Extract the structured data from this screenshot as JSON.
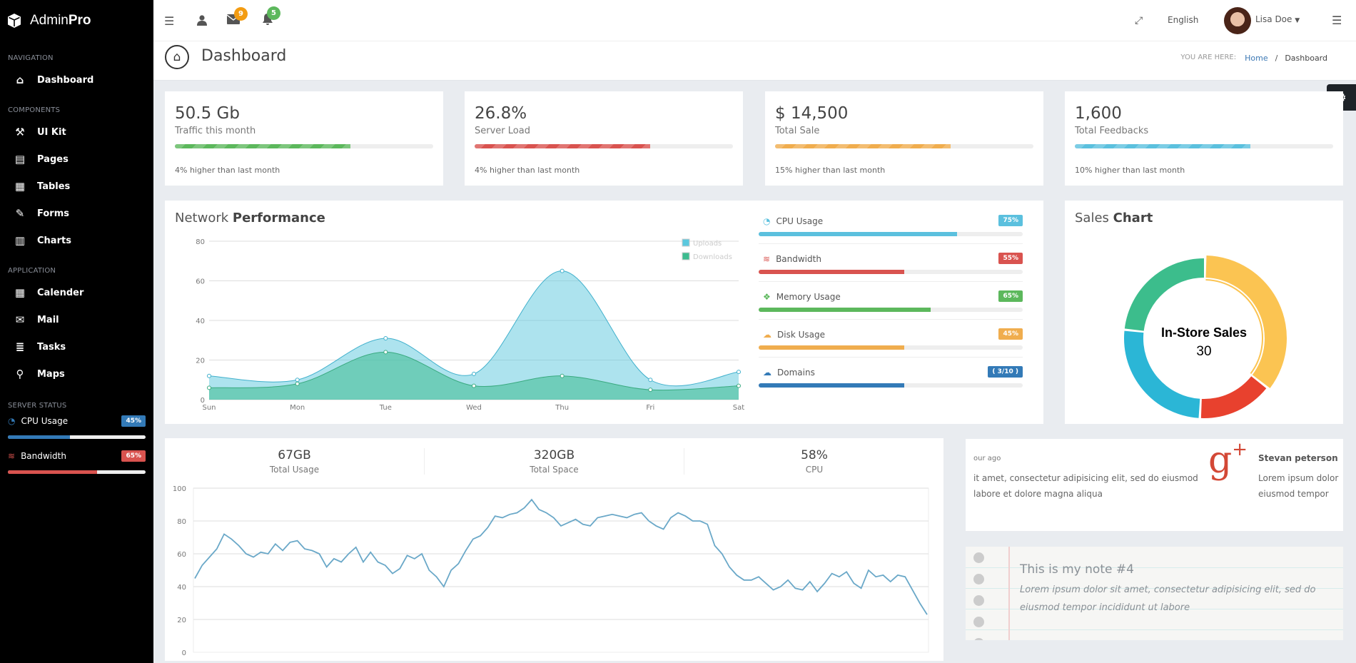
{
  "brand": {
    "light": "Admin",
    "bold": "Pro"
  },
  "sidebar": {
    "sections": [
      {
        "label": "NAVIGATION",
        "items": [
          {
            "label": "Dashboard",
            "icon": "home-icon"
          }
        ]
      },
      {
        "label": "COMPONENTS",
        "items": [
          {
            "label": "UI Kit",
            "icon": "magic-wand-icon"
          },
          {
            "label": "Pages",
            "icon": "file-icon"
          },
          {
            "label": "Tables",
            "icon": "table-icon"
          },
          {
            "label": "Forms",
            "icon": "pencil-icon"
          },
          {
            "label": "Charts",
            "icon": "bar-chart-icon"
          }
        ]
      },
      {
        "label": "APPLICATION",
        "items": [
          {
            "label": "Calender",
            "icon": "calendar-icon"
          },
          {
            "label": "Mail",
            "icon": "envelope-icon"
          },
          {
            "label": "Tasks",
            "icon": "tasks-icon"
          },
          {
            "label": "Maps",
            "icon": "map-marker-icon"
          }
        ]
      }
    ],
    "server_status": {
      "label": "SERVER STATUS",
      "items": [
        {
          "label": "CPU Usage",
          "badge": "45%",
          "value": 45,
          "color": "#337ab7"
        },
        {
          "label": "Bandwidth",
          "badge": "65%",
          "value": 65,
          "color": "#d9534f"
        }
      ]
    }
  },
  "topbar": {
    "messages_count": "9",
    "notifications_count": "5",
    "language": "English",
    "user_name": "Lisa Doe"
  },
  "page": {
    "title": "Dashboard",
    "breadcrumb_label": "YOU ARE HERE:",
    "breadcrumb_home": "Home",
    "breadcrumb_sep": "/",
    "breadcrumb_current": "Dashboard"
  },
  "stats": [
    {
      "value": "50.5 Gb",
      "label": "Traffic this month",
      "note": "4% higher than last month",
      "progress": 68,
      "color": "#5cb85c"
    },
    {
      "value": "26.8%",
      "label": "Server Load",
      "note": "4% higher than last month",
      "progress": 68,
      "color": "#d9534f"
    },
    {
      "value": "$ 14,500",
      "label": "Total Sale",
      "note": "15% higher than last month",
      "progress": 68,
      "color": "#f0ad4e"
    },
    {
      "value": "1,600",
      "label": "Total Feedbacks",
      "note": "10% higher than last month",
      "progress": 68,
      "color": "#5bc0de"
    }
  ],
  "network": {
    "title_light": "Network",
    "title_bold": "Performance"
  },
  "resources": [
    {
      "label": "CPU Usage",
      "badge": "75%",
      "value": 75,
      "color": "#5bc0de",
      "icon": "dashboard-icon"
    },
    {
      "label": "Bandwidth",
      "badge": "55%",
      "value": 55,
      "color": "#d9534f",
      "icon": "database-icon"
    },
    {
      "label": "Memory Usage",
      "badge": "65%",
      "value": 65,
      "color": "#5cb85c",
      "icon": "cubes-icon"
    },
    {
      "label": "Disk Usage",
      "badge": "45%",
      "value": 55,
      "color": "#f0ad4e",
      "icon": "cloud-download-icon"
    },
    {
      "label": "Domains",
      "badge": "( 3/10 )",
      "value": 55,
      "color": "#337ab7",
      "icon": "cloud-download-icon"
    }
  ],
  "sales": {
    "title_light": "Sales",
    "title_bold": "Chart"
  },
  "usage": {
    "kpis": [
      {
        "value": "67GB",
        "label": "Total Usage"
      },
      {
        "value": "320GB",
        "label": "Total Space"
      },
      {
        "value": "58%",
        "label": "CPU"
      }
    ]
  },
  "social": {
    "time": "our ago",
    "text1": "it amet, consectetur adipisicing elit, sed do eiusmod",
    "text2": "labore et dolore magna aliqua",
    "name": "Stevan peterson",
    "text3": "Lorem ipsum dolor",
    "text4": "eiusmod tempor"
  },
  "note": {
    "title": "This is my note #4",
    "body": "Lorem ipsum dolor sit amet, consectetur adipisicing elit, sed do eiusmod tempor incididunt ut labore"
  },
  "chart_data": [
    {
      "type": "area",
      "x": [
        "Sun",
        "Mon",
        "Tue",
        "Wed",
        "Thu",
        "Fri",
        "Sat"
      ],
      "ylim": [
        0,
        80
      ],
      "yticks": [
        0,
        20,
        40,
        60,
        80
      ],
      "grid": true,
      "legend": "top-right",
      "series": [
        {
          "name": "Uploads",
          "color": "#5bc8de",
          "values": [
            12,
            10,
            31,
            13,
            65,
            10,
            14
          ]
        },
        {
          "name": "Downloads",
          "color": "#3dbc8f",
          "values": [
            6,
            8,
            24,
            7,
            12,
            5,
            7
          ]
        }
      ]
    },
    {
      "type": "pie",
      "center_label": "In-Store Sales",
      "center_value": "30",
      "values": [
        30,
        13,
        22,
        20
      ],
      "colors": [
        "#fbc452",
        "#e8412e",
        "#2bb6d6",
        "#3cbd8c"
      ]
    },
    {
      "type": "line",
      "ylim": [
        0,
        100
      ],
      "yticks": [
        0,
        20,
        40,
        60,
        80,
        100
      ],
      "grid": true,
      "color": "#6aa8c8",
      "values": [
        45,
        53,
        58,
        63,
        72,
        69,
        65,
        60,
        58,
        61,
        60,
        66,
        62,
        67,
        68,
        63,
        62,
        60,
        52,
        57,
        55,
        60,
        64,
        55,
        61,
        55,
        53,
        48,
        51,
        59,
        57,
        60,
        50,
        46,
        40,
        50,
        54,
        62,
        69,
        71,
        76,
        83,
        82,
        84,
        85,
        88,
        93,
        87,
        85,
        82,
        77,
        79,
        81,
        78,
        77,
        82,
        83,
        84,
        83,
        82,
        84,
        85,
        80,
        77,
        75,
        82,
        85,
        83,
        80,
        80,
        78,
        65,
        60,
        52,
        47,
        44,
        44,
        46,
        42,
        38,
        40,
        44,
        39,
        38,
        43,
        37,
        42,
        48,
        46,
        49,
        42,
        39,
        50,
        46,
        47,
        43,
        47,
        46,
        38,
        30,
        23
      ]
    }
  ]
}
